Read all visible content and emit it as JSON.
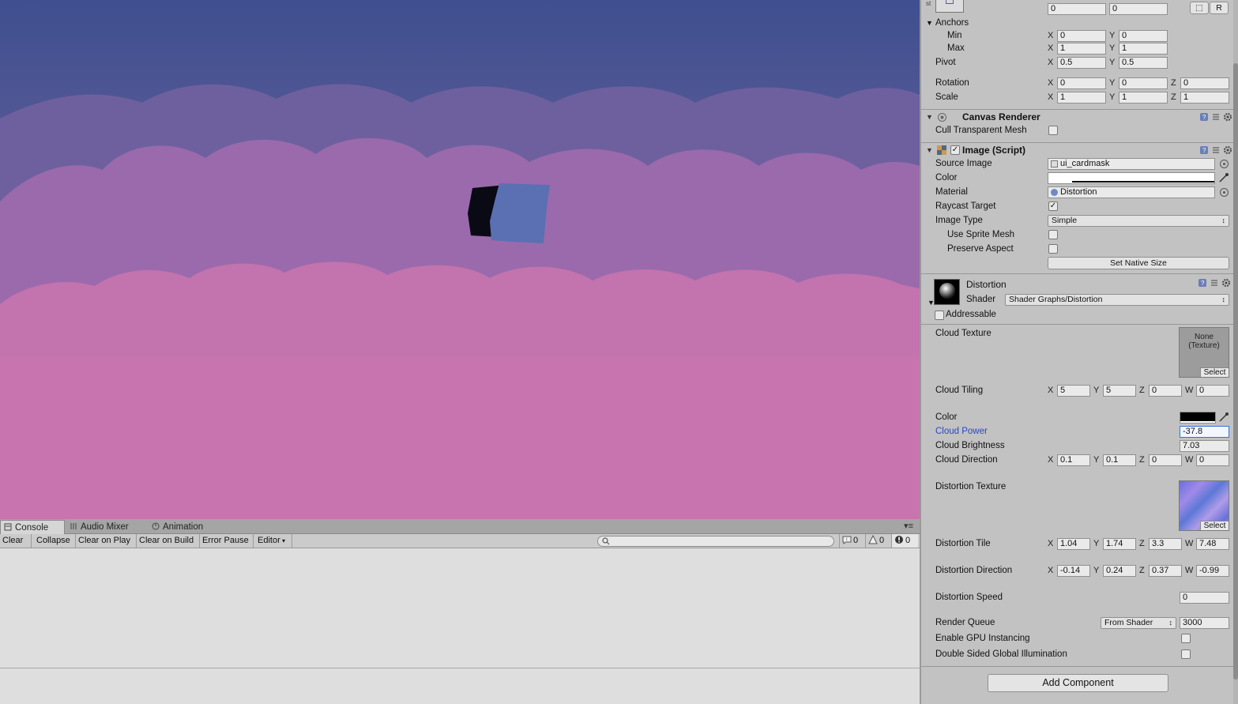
{
  "console": {
    "tabs": [
      {
        "label": "Console",
        "icon": "console-icon"
      },
      {
        "label": "Audio Mixer",
        "icon": "audio-mixer-icon"
      },
      {
        "label": "Animation",
        "icon": "animation-icon"
      }
    ],
    "toolbar": {
      "clear": "Clear",
      "collapse": "Collapse",
      "clear_on_play": "Clear on Play",
      "clear_on_build": "Clear on Build",
      "error_pause": "Error Pause",
      "editor": "Editor",
      "search_placeholder": ""
    },
    "counts": {
      "info": "0",
      "warnings": "0",
      "errors": "0"
    }
  },
  "inspector": {
    "rect_transform": {
      "top_values": [
        "0",
        "0"
      ],
      "raw_button": "R",
      "anchors_label": "Anchors",
      "min_label": "Min",
      "max_label": "Max",
      "pivot_label": "Pivot",
      "rotation_label": "Rotation",
      "scale_label": "Scale",
      "anchors_min": {
        "x": "0",
        "y": "0"
      },
      "anchors_max": {
        "x": "1",
        "y": "1"
      },
      "pivot": {
        "x": "0.5",
        "y": "0.5"
      },
      "rotation": {
        "x": "0",
        "y": "0",
        "z": "0"
      },
      "scale": {
        "x": "1",
        "y": "1",
        "z": "1"
      }
    },
    "canvas_renderer": {
      "title": "Canvas Renderer",
      "cull_label": "Cull Transparent Mesh",
      "cull": false
    },
    "image": {
      "title": "Image (Script)",
      "source_image_label": "Source Image",
      "source_image": "ui_cardmask",
      "color_label": "Color",
      "material_label": "Material",
      "material": "Distortion",
      "raycast_label": "Raycast Target",
      "raycast": true,
      "image_type_label": "Image Type",
      "image_type": "Simple",
      "use_sprite_mesh_label": "Use Sprite Mesh",
      "preserve_aspect_label": "Preserve Aspect",
      "set_native_size": "Set Native Size"
    },
    "material": {
      "name": "Distortion",
      "shader_label": "Shader",
      "shader": "Shader Graphs/Distortion",
      "addressable_label": "Addressable",
      "cloud_texture_label": "Cloud Texture",
      "cloud_texture_none": "None\n(Texture)",
      "select_label": "Select",
      "cloud_tiling_label": "Cloud Tiling",
      "cloud_tiling": {
        "x": "5",
        "y": "5",
        "z": "0",
        "w": "0"
      },
      "color_label": "Color",
      "cloud_power_label": "Cloud Power",
      "cloud_power": "-37.8",
      "cloud_brightness_label": "Cloud Brightness",
      "cloud_brightness": "7.03",
      "cloud_direction_label": "Cloud Direction",
      "cloud_direction": {
        "x": "0.1",
        "y": "0.1",
        "z": "0",
        "w": "0"
      },
      "distortion_texture_label": "Distortion Texture",
      "distortion_tile_label": "Distortion Tile",
      "distortion_tile": {
        "x": "1.04",
        "y": "1.74",
        "z": "3.3",
        "w": "7.48"
      },
      "distortion_direction_label": "Distortion Direction",
      "distortion_direction": {
        "x": "-0.14",
        "y": "0.24",
        "z": "0.37",
        "w": "-0.99"
      },
      "distortion_speed_label": "Distortion Speed",
      "distortion_speed": "0",
      "render_queue_label": "Render Queue",
      "render_queue_mode": "From Shader",
      "render_queue": "3000",
      "gpu_instancing_label": "Enable GPU Instancing",
      "double_sided_label": "Double Sided Global Illumination"
    },
    "add_component": "Add Component",
    "axis": {
      "x": "X",
      "y": "Y",
      "z": "Z",
      "w": "W"
    }
  },
  "colors": {
    "sky_top": "#41518f",
    "sky_bottom": "#c873ac",
    "accent_focus": "#3d6fd8",
    "label_highlight": "#2a48c4"
  }
}
